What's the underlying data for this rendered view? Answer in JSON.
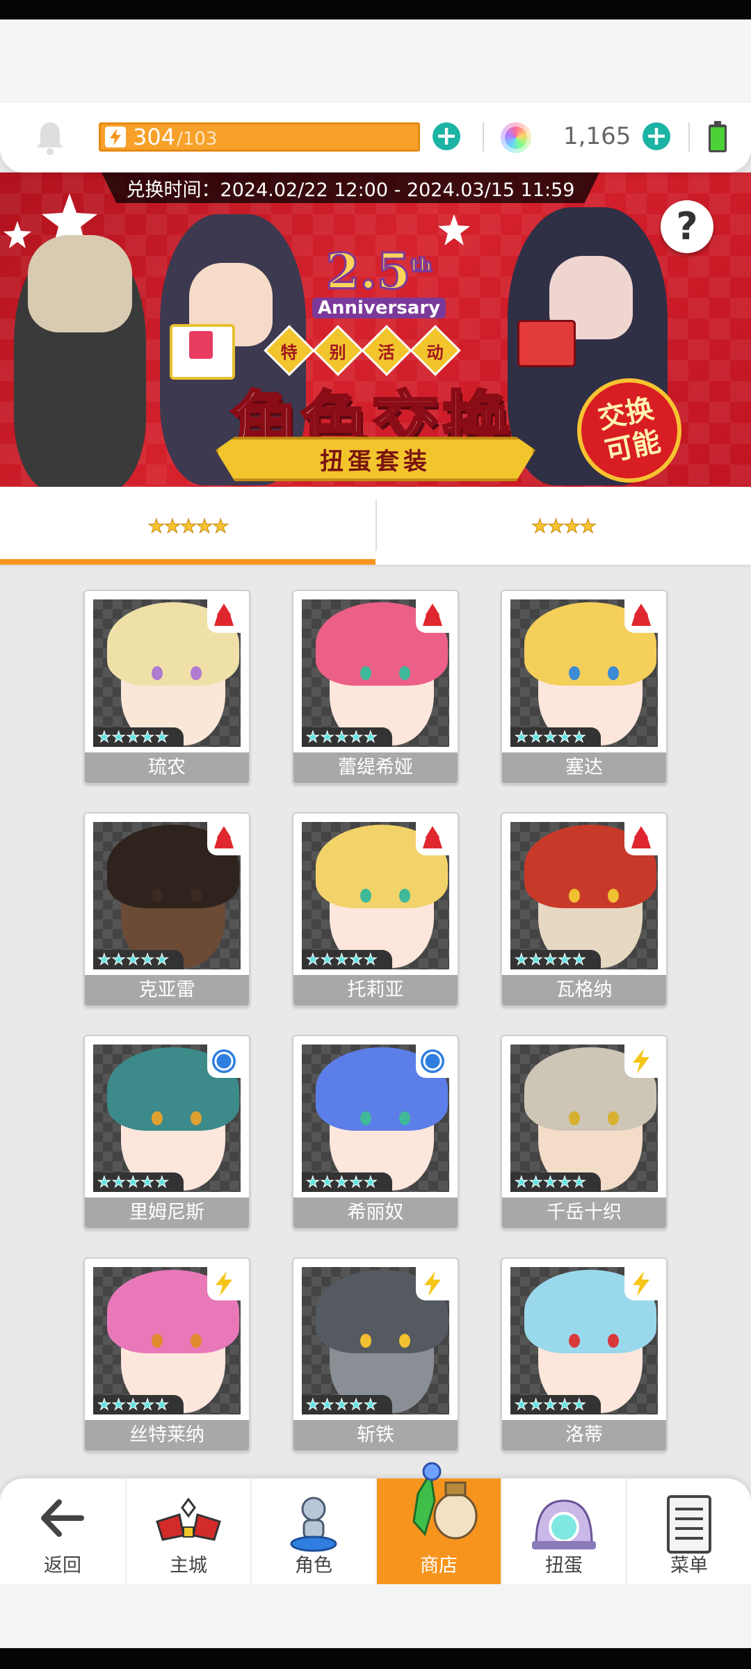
{
  "header": {
    "energy_current": "304",
    "energy_max": "/103",
    "gems": "1,165"
  },
  "banner": {
    "exchange_time": "兑换时间：2024.02/22 12:00 - 2024.03/15 11:59",
    "anniversary_number": "2.5",
    "anniversary_suffix": "th",
    "anniversary_word": "Anniversary",
    "special_chars": [
      "特",
      "别",
      "活",
      "动"
    ],
    "title": "角色交换",
    "subtitle": "扭蛋套装",
    "badge": "交换可能",
    "help_label": "?"
  },
  "tabs": [
    {
      "label": "★★★★★",
      "active": true
    },
    {
      "label": "★★★★",
      "active": false
    }
  ],
  "characters": [
    {
      "name": "琉农",
      "stars": 5,
      "element": "fire"
    },
    {
      "name": "蕾缇希娅",
      "stars": 5,
      "element": "fire"
    },
    {
      "name": "塞达",
      "stars": 5,
      "element": "fire"
    },
    {
      "name": "克亚雷",
      "stars": 5,
      "element": "fire"
    },
    {
      "name": "托莉亚",
      "stars": 5,
      "element": "fire"
    },
    {
      "name": "瓦格纳",
      "stars": 5,
      "element": "fire"
    },
    {
      "name": "里姆尼斯",
      "stars": 5,
      "element": "water"
    },
    {
      "name": "希丽奴",
      "stars": 5,
      "element": "water"
    },
    {
      "name": "千岳十织",
      "stars": 5,
      "element": "thunder"
    },
    {
      "name": "丝特莱纳",
      "stars": 5,
      "element": "thunder"
    },
    {
      "name": "斩铁",
      "stars": 5,
      "element": "thunder"
    },
    {
      "name": "洛蒂",
      "stars": 5,
      "element": "thunder"
    }
  ],
  "nav": [
    {
      "label": "返回",
      "icon": "back-arrow-icon"
    },
    {
      "label": "主城",
      "icon": "castle-icon"
    },
    {
      "label": "角色",
      "icon": "character-icon"
    },
    {
      "label": "商店",
      "icon": "shop-icon",
      "active": true
    },
    {
      "label": "扭蛋",
      "icon": "gacha-icon"
    },
    {
      "label": "菜单",
      "icon": "menu-icon"
    }
  ],
  "colors": {
    "accent_orange": "#f7941d",
    "banner_red": "#d6222d",
    "plus_teal": "#1bb3a4"
  }
}
